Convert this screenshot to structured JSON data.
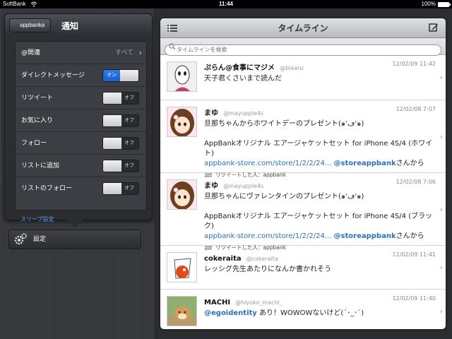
{
  "status_bar": {
    "carrier": "SoftBank",
    "time": "11:44",
    "battery": "100%"
  },
  "popover": {
    "back_label": "appbanka",
    "title": "通知",
    "rows": [
      {
        "label": "@関連",
        "value": "すべて"
      },
      {
        "label": "ダイレクトメッセージ",
        "toggle": "オン"
      },
      {
        "label": "リツイート",
        "toggle": "オフ"
      },
      {
        "label": "お気に入り",
        "toggle": "オフ"
      },
      {
        "label": "フォロー",
        "toggle": "オフ"
      },
      {
        "label": "リストに追加",
        "toggle": "オフ"
      },
      {
        "label": "リストのフォロー",
        "toggle": "オフ"
      }
    ],
    "sleep_label": "スリープ設定"
  },
  "settings_item": {
    "label": "設定"
  },
  "timeline": {
    "title": "タイムライン",
    "search_placeholder": "タイムラインを検索",
    "tweets": [
      {
        "name": "ぷらん@食事にマジメ",
        "handle": "@blaanc",
        "time": "12/02/09 11:42",
        "text": "天子君くさいまで読んだ"
      },
      {
        "name": "まゆ",
        "handle": "@mayupple4s",
        "time": "12/02/08 7:07",
        "line1": "旦那ちゃんからホワイトデーのプレゼント(๑'ڡ'๑)",
        "line2": "AppBankオリジナル エアージャケットセット for iPhone 4S/4 (ホワイト)",
        "link": "appbank-store.com/store/1/2/2/24...",
        "mention": "@storeappbank",
        "suffix": "さんから",
        "rt_label": "リツイートした人：appbank"
      },
      {
        "name": "まゆ",
        "handle": "@mayupple4s",
        "time": "12/02/08 7:06",
        "line1": "旦那ちゃんにヴァレンタインのプレゼント(๑'ڡ'๑)",
        "line2": "AppBankオリジナル エアージャケットセット for iPhone 4S/4 (ブラック)",
        "link": "appbank-store.com/store/1/2/2/24...",
        "mention": "@storeappbank",
        "suffix": "さんから",
        "rt_label": "リツイートした人：appbank"
      },
      {
        "name": "cokeraita",
        "handle": "@cokeraita",
        "time": "12/02/09 11:41",
        "text": "レッシグ先生あたりになんか書かれそう"
      },
      {
        "name": "MACHI",
        "handle": "@hiyoko_machi_",
        "time": "12/02/09 11:40",
        "mention": "@egoidentity",
        "text": " あり！WOWOWないけど(´･_･`)"
      }
    ]
  },
  "colors": {
    "accent_blue": "#2f7ae8",
    "link_blue": "#2c6fb8",
    "popover_bg": "#2a2c30"
  }
}
